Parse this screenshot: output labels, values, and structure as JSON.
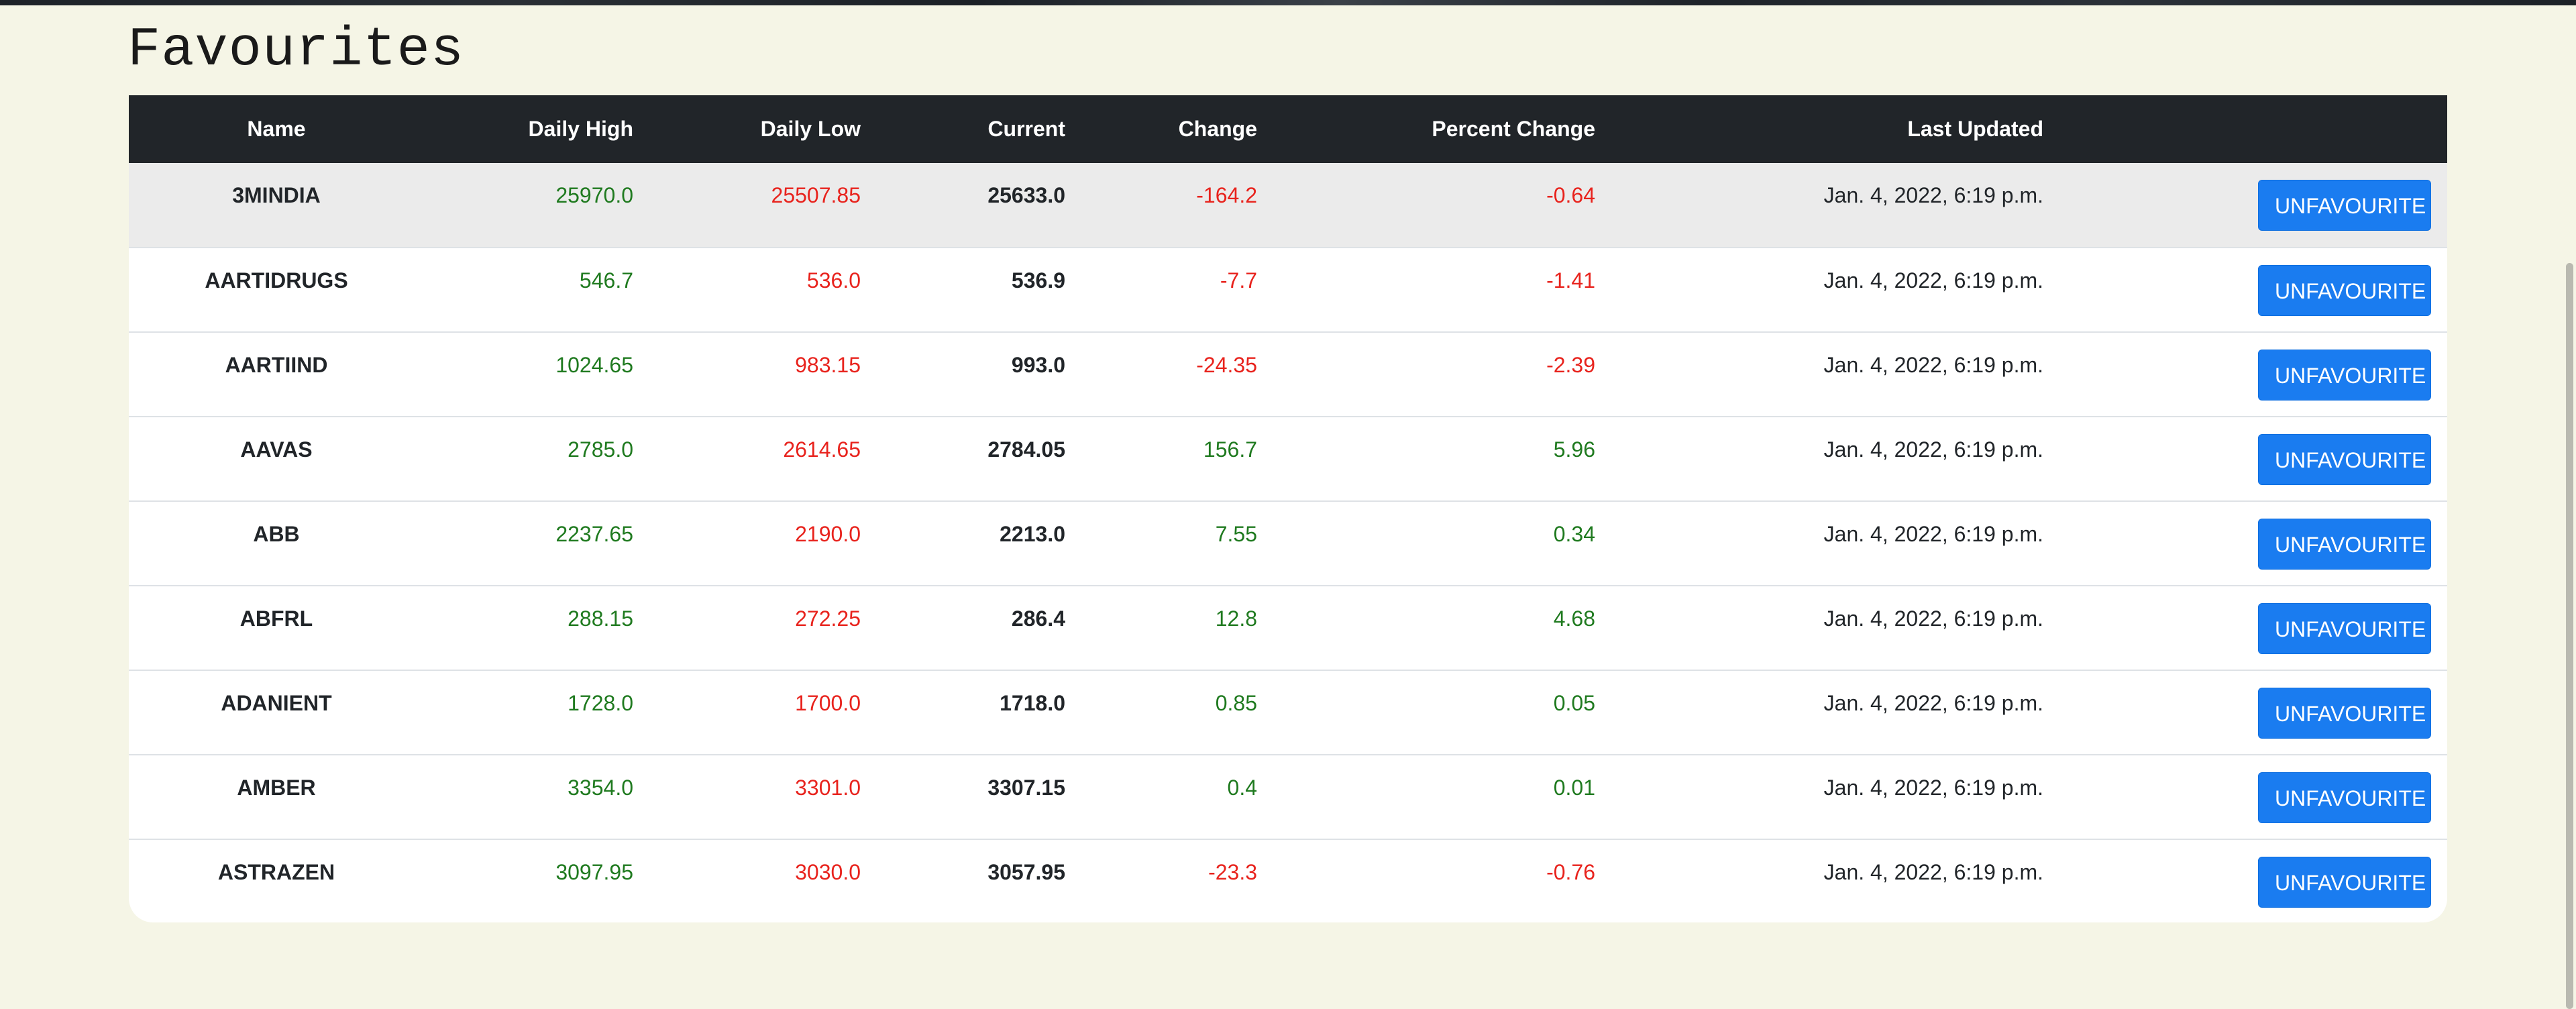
{
  "page": {
    "title": "Favourites"
  },
  "table": {
    "columns": [
      "Name",
      "Daily High",
      "Daily Low",
      "Current",
      "Change",
      "Percent Change",
      "Last Updated",
      ""
    ],
    "action_label": "UNFAVOURITE",
    "colors": {
      "positive": "#1f7a1f",
      "negative": "#e8231d",
      "header_bg": "#212529",
      "button_bg": "#1a7cf0"
    },
    "rows": [
      {
        "name": "3MINDIA",
        "high": "25970.0",
        "low": "25507.85",
        "current": "25633.0",
        "change": "-164.2",
        "pct": "-0.64",
        "updated": "Jan. 4, 2022, 6:19 p.m.",
        "trend": "neg"
      },
      {
        "name": "AARTIDRUGS",
        "high": "546.7",
        "low": "536.0",
        "current": "536.9",
        "change": "-7.7",
        "pct": "-1.41",
        "updated": "Jan. 4, 2022, 6:19 p.m.",
        "trend": "neg"
      },
      {
        "name": "AARTIIND",
        "high": "1024.65",
        "low": "983.15",
        "current": "993.0",
        "change": "-24.35",
        "pct": "-2.39",
        "updated": "Jan. 4, 2022, 6:19 p.m.",
        "trend": "neg"
      },
      {
        "name": "AAVAS",
        "high": "2785.0",
        "low": "2614.65",
        "current": "2784.05",
        "change": "156.7",
        "pct": "5.96",
        "updated": "Jan. 4, 2022, 6:19 p.m.",
        "trend": "pos"
      },
      {
        "name": "ABB",
        "high": "2237.65",
        "low": "2190.0",
        "current": "2213.0",
        "change": "7.55",
        "pct": "0.34",
        "updated": "Jan. 4, 2022, 6:19 p.m.",
        "trend": "pos"
      },
      {
        "name": "ABFRL",
        "high": "288.15",
        "low": "272.25",
        "current": "286.4",
        "change": "12.8",
        "pct": "4.68",
        "updated": "Jan. 4, 2022, 6:19 p.m.",
        "trend": "pos"
      },
      {
        "name": "ADANIENT",
        "high": "1728.0",
        "low": "1700.0",
        "current": "1718.0",
        "change": "0.85",
        "pct": "0.05",
        "updated": "Jan. 4, 2022, 6:19 p.m.",
        "trend": "pos"
      },
      {
        "name": "AMBER",
        "high": "3354.0",
        "low": "3301.0",
        "current": "3307.15",
        "change": "0.4",
        "pct": "0.01",
        "updated": "Jan. 4, 2022, 6:19 p.m.",
        "trend": "pos"
      },
      {
        "name": "ASTRAZEN",
        "high": "3097.95",
        "low": "3030.0",
        "current": "3057.95",
        "change": "-23.3",
        "pct": "-0.76",
        "updated": "Jan. 4, 2022, 6:19 p.m.",
        "trend": "neg"
      }
    ]
  }
}
